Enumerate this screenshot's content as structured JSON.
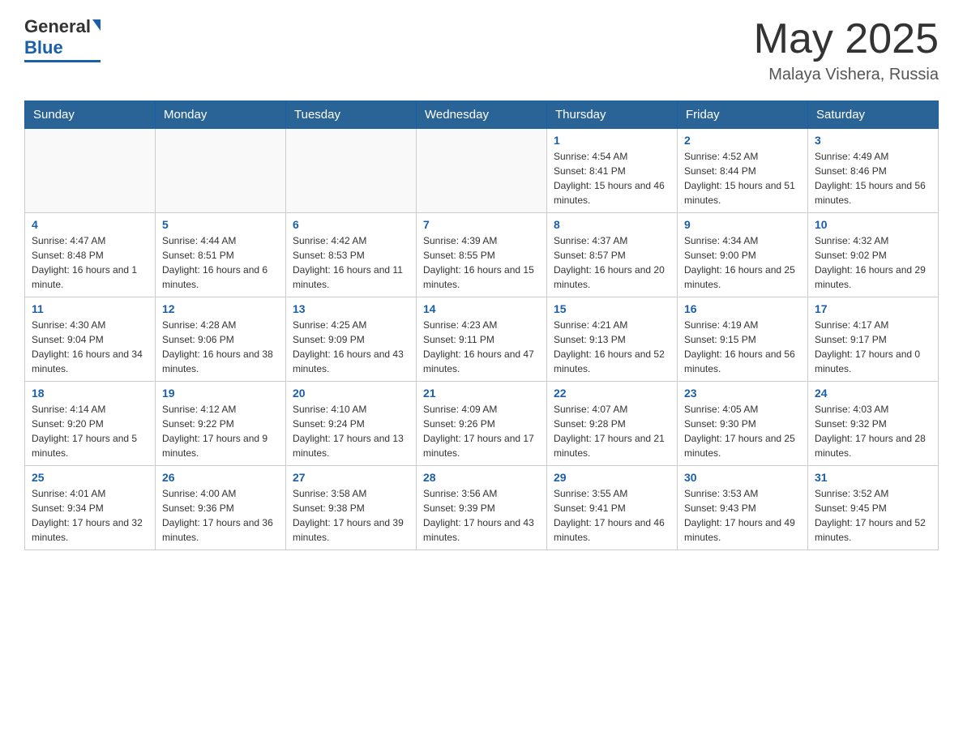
{
  "header": {
    "logo_general": "General",
    "logo_blue": "Blue",
    "month_title": "May 2025",
    "location": "Malaya Vishera, Russia"
  },
  "weekdays": [
    "Sunday",
    "Monday",
    "Tuesday",
    "Wednesday",
    "Thursday",
    "Friday",
    "Saturday"
  ],
  "weeks": [
    [
      {
        "day": "",
        "info": ""
      },
      {
        "day": "",
        "info": ""
      },
      {
        "day": "",
        "info": ""
      },
      {
        "day": "",
        "info": ""
      },
      {
        "day": "1",
        "info": "Sunrise: 4:54 AM\nSunset: 8:41 PM\nDaylight: 15 hours and 46 minutes."
      },
      {
        "day": "2",
        "info": "Sunrise: 4:52 AM\nSunset: 8:44 PM\nDaylight: 15 hours and 51 minutes."
      },
      {
        "day": "3",
        "info": "Sunrise: 4:49 AM\nSunset: 8:46 PM\nDaylight: 15 hours and 56 minutes."
      }
    ],
    [
      {
        "day": "4",
        "info": "Sunrise: 4:47 AM\nSunset: 8:48 PM\nDaylight: 16 hours and 1 minute."
      },
      {
        "day": "5",
        "info": "Sunrise: 4:44 AM\nSunset: 8:51 PM\nDaylight: 16 hours and 6 minutes."
      },
      {
        "day": "6",
        "info": "Sunrise: 4:42 AM\nSunset: 8:53 PM\nDaylight: 16 hours and 11 minutes."
      },
      {
        "day": "7",
        "info": "Sunrise: 4:39 AM\nSunset: 8:55 PM\nDaylight: 16 hours and 15 minutes."
      },
      {
        "day": "8",
        "info": "Sunrise: 4:37 AM\nSunset: 8:57 PM\nDaylight: 16 hours and 20 minutes."
      },
      {
        "day": "9",
        "info": "Sunrise: 4:34 AM\nSunset: 9:00 PM\nDaylight: 16 hours and 25 minutes."
      },
      {
        "day": "10",
        "info": "Sunrise: 4:32 AM\nSunset: 9:02 PM\nDaylight: 16 hours and 29 minutes."
      }
    ],
    [
      {
        "day": "11",
        "info": "Sunrise: 4:30 AM\nSunset: 9:04 PM\nDaylight: 16 hours and 34 minutes."
      },
      {
        "day": "12",
        "info": "Sunrise: 4:28 AM\nSunset: 9:06 PM\nDaylight: 16 hours and 38 minutes."
      },
      {
        "day": "13",
        "info": "Sunrise: 4:25 AM\nSunset: 9:09 PM\nDaylight: 16 hours and 43 minutes."
      },
      {
        "day": "14",
        "info": "Sunrise: 4:23 AM\nSunset: 9:11 PM\nDaylight: 16 hours and 47 minutes."
      },
      {
        "day": "15",
        "info": "Sunrise: 4:21 AM\nSunset: 9:13 PM\nDaylight: 16 hours and 52 minutes."
      },
      {
        "day": "16",
        "info": "Sunrise: 4:19 AM\nSunset: 9:15 PM\nDaylight: 16 hours and 56 minutes."
      },
      {
        "day": "17",
        "info": "Sunrise: 4:17 AM\nSunset: 9:17 PM\nDaylight: 17 hours and 0 minutes."
      }
    ],
    [
      {
        "day": "18",
        "info": "Sunrise: 4:14 AM\nSunset: 9:20 PM\nDaylight: 17 hours and 5 minutes."
      },
      {
        "day": "19",
        "info": "Sunrise: 4:12 AM\nSunset: 9:22 PM\nDaylight: 17 hours and 9 minutes."
      },
      {
        "day": "20",
        "info": "Sunrise: 4:10 AM\nSunset: 9:24 PM\nDaylight: 17 hours and 13 minutes."
      },
      {
        "day": "21",
        "info": "Sunrise: 4:09 AM\nSunset: 9:26 PM\nDaylight: 17 hours and 17 minutes."
      },
      {
        "day": "22",
        "info": "Sunrise: 4:07 AM\nSunset: 9:28 PM\nDaylight: 17 hours and 21 minutes."
      },
      {
        "day": "23",
        "info": "Sunrise: 4:05 AM\nSunset: 9:30 PM\nDaylight: 17 hours and 25 minutes."
      },
      {
        "day": "24",
        "info": "Sunrise: 4:03 AM\nSunset: 9:32 PM\nDaylight: 17 hours and 28 minutes."
      }
    ],
    [
      {
        "day": "25",
        "info": "Sunrise: 4:01 AM\nSunset: 9:34 PM\nDaylight: 17 hours and 32 minutes."
      },
      {
        "day": "26",
        "info": "Sunrise: 4:00 AM\nSunset: 9:36 PM\nDaylight: 17 hours and 36 minutes."
      },
      {
        "day": "27",
        "info": "Sunrise: 3:58 AM\nSunset: 9:38 PM\nDaylight: 17 hours and 39 minutes."
      },
      {
        "day": "28",
        "info": "Sunrise: 3:56 AM\nSunset: 9:39 PM\nDaylight: 17 hours and 43 minutes."
      },
      {
        "day": "29",
        "info": "Sunrise: 3:55 AM\nSunset: 9:41 PM\nDaylight: 17 hours and 46 minutes."
      },
      {
        "day": "30",
        "info": "Sunrise: 3:53 AM\nSunset: 9:43 PM\nDaylight: 17 hours and 49 minutes."
      },
      {
        "day": "31",
        "info": "Sunrise: 3:52 AM\nSunset: 9:45 PM\nDaylight: 17 hours and 52 minutes."
      }
    ]
  ]
}
